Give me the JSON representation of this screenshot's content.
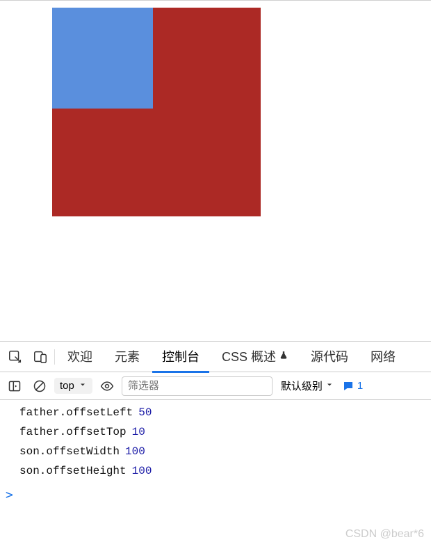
{
  "tabs": {
    "welcome": "欢迎",
    "elements": "元素",
    "console": "控制台",
    "cssOverview": "CSS 概述",
    "sources": "源代码",
    "network": "网络"
  },
  "toolbar": {
    "frame": "top",
    "filterPlaceholder": "筛选器",
    "level": "默认级别",
    "issuesCount": "1"
  },
  "logs": [
    {
      "key": "father.offsetLeft",
      "value": "50"
    },
    {
      "key": "father.offsetTop",
      "value": "10"
    },
    {
      "key": "son.offsetWidth",
      "value": "100"
    },
    {
      "key": "son.offsetHeight",
      "value": "100"
    }
  ],
  "prompt": ">",
  "watermark": "CSDN @bear*6"
}
